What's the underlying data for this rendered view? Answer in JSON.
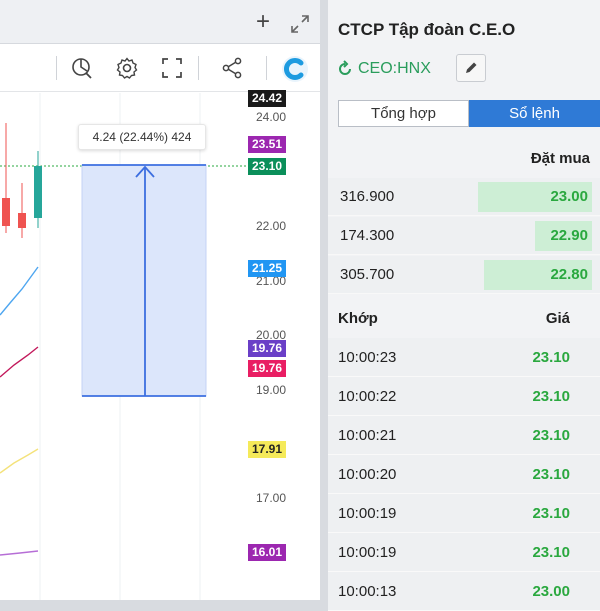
{
  "chart": {
    "price_axis": [
      "24.00",
      "22.00",
      "21.00",
      "20.00",
      "19.00",
      "17.00"
    ],
    "tags": {
      "top": "24.42",
      "high": "23.51",
      "last": "23.10",
      "blue": "21.25",
      "purple_1": "19.76",
      "red": "19.76",
      "yellow": "17.91",
      "purple_2": "16.01"
    },
    "measure_label": "4.24 (22.44%) 424",
    "colors": {
      "up": "#26a69a",
      "down": "#ef5350",
      "measure_fill": "#dce6fb",
      "measure_stroke": "#3d6fe0"
    }
  },
  "toolbar": {
    "icons": [
      "plus-icon",
      "expand-icon",
      "chart-analysis-icon",
      "gear-icon",
      "fullscreen-icon",
      "share-icon",
      "c-logo-icon"
    ]
  },
  "sidebar": {
    "company_name": "CTCP Tập đoàn C.E.O",
    "ticker": "CEO:HNX",
    "tabs": [
      {
        "label": "Tổng hợp",
        "active": false
      },
      {
        "label": "Sổ lệnh",
        "active": true
      }
    ],
    "bid_header": "Đặt mua",
    "bids": [
      {
        "qty": "316.900",
        "price": "23.00",
        "bar": 0.6
      },
      {
        "qty": "174.300",
        "price": "22.90",
        "bar": 0.3
      },
      {
        "qty": "305.700",
        "price": "22.80",
        "bar": 0.57
      }
    ],
    "trade_headers": {
      "time": "Khớp",
      "price": "Giá"
    },
    "trades": [
      {
        "time": "10:00:23",
        "price": "23.10"
      },
      {
        "time": "10:00:22",
        "price": "23.10"
      },
      {
        "time": "10:00:21",
        "price": "23.10"
      },
      {
        "time": "10:00:20",
        "price": "23.10"
      },
      {
        "time": "10:00:19",
        "price": "23.10"
      },
      {
        "time": "10:00:19",
        "price": "23.10"
      },
      {
        "time": "10:00:13",
        "price": "23.00"
      }
    ]
  }
}
